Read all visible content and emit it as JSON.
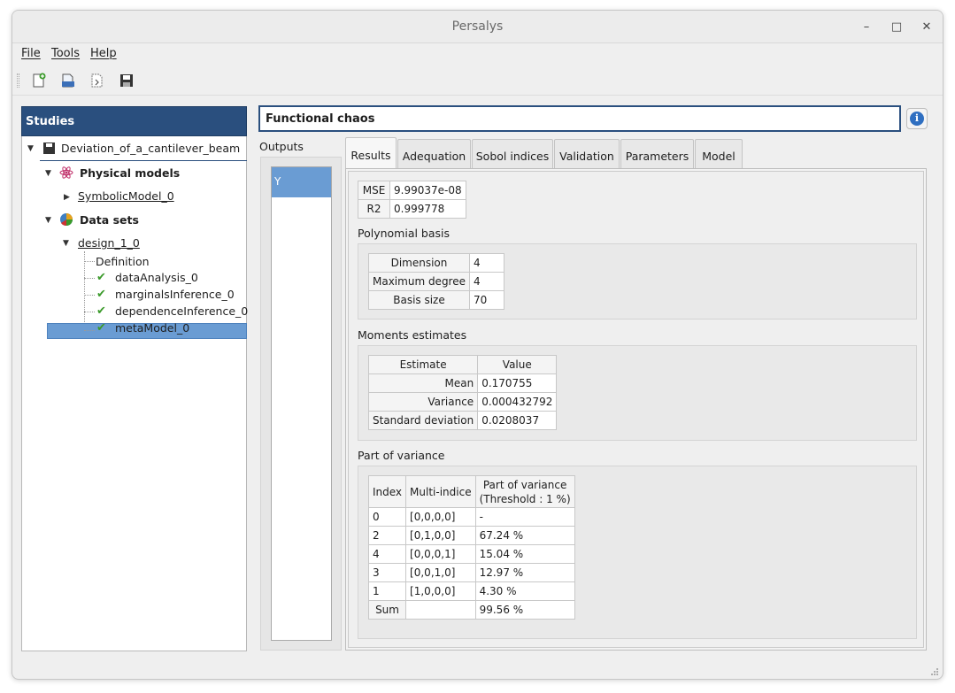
{
  "window": {
    "title": "Persalys"
  },
  "window_controls": {
    "minimize": "–",
    "maximize": "□",
    "close": "✕"
  },
  "menus": [
    "File",
    "Tools",
    "Help"
  ],
  "toolbar": {
    "buttons": [
      "new-study",
      "open-study",
      "import-script",
      "save-study"
    ]
  },
  "studies": {
    "header": "Studies",
    "study": "Deviation_of_a_cantilever_beam",
    "physical_models_label": "Physical models",
    "symbolic_model": "SymbolicModel_0",
    "data_sets_label": "Data sets",
    "design": "design_1_0",
    "children": [
      "Definition",
      "dataAnalysis_0",
      "marginalsInference_0",
      "dependenceInference_0",
      "metaModel_0"
    ],
    "selected": "metaModel_0"
  },
  "analysis": {
    "title": "Functional chaos",
    "info_icon": "i"
  },
  "outputs": {
    "label": "Outputs",
    "items": [
      "Y"
    ]
  },
  "tabs": [
    "Results",
    "Adequation",
    "Sobol indices",
    "Validation",
    "Parameters",
    "Model"
  ],
  "active_tab": "Results",
  "results": {
    "error": {
      "rows": [
        [
          "MSE",
          "9.99037e-08"
        ],
        [
          "R2",
          "0.999778"
        ]
      ]
    },
    "polynomial_basis": {
      "label": "Polynomial basis",
      "rows": [
        [
          "Dimension",
          "4"
        ],
        [
          "Maximum degree",
          "4"
        ],
        [
          "Basis size",
          "70"
        ]
      ]
    },
    "moments": {
      "label": "Moments estimates",
      "headers": [
        "Estimate",
        "Value"
      ],
      "rows": [
        [
          "Mean",
          "0.170755"
        ],
        [
          "Variance",
          "0.000432792"
        ],
        [
          "Standard deviation",
          "0.0208037"
        ]
      ]
    },
    "part_of_variance": {
      "label": "Part of variance",
      "headers": [
        "Index",
        "Multi-indice",
        "Part of variance",
        "(Threshold : 1 %)"
      ],
      "rows": [
        [
          "0",
          "[0,0,0,0]",
          "-"
        ],
        [
          "2",
          "[0,1,0,0]",
          "67.24 %"
        ],
        [
          "4",
          "[0,0,0,1]",
          "15.04 %"
        ],
        [
          "3",
          "[0,0,1,0]",
          "12.97 %"
        ],
        [
          "1",
          "[1,0,0,0]",
          "4.30 %"
        ]
      ],
      "sum_row": [
        "Sum",
        "",
        "99.56 %"
      ]
    }
  },
  "colors": {
    "header_blue": "#2a4f7e",
    "selection_blue": "#6a9cd3",
    "check_green": "#3b9a2b",
    "info_blue": "#2f6fc1"
  }
}
